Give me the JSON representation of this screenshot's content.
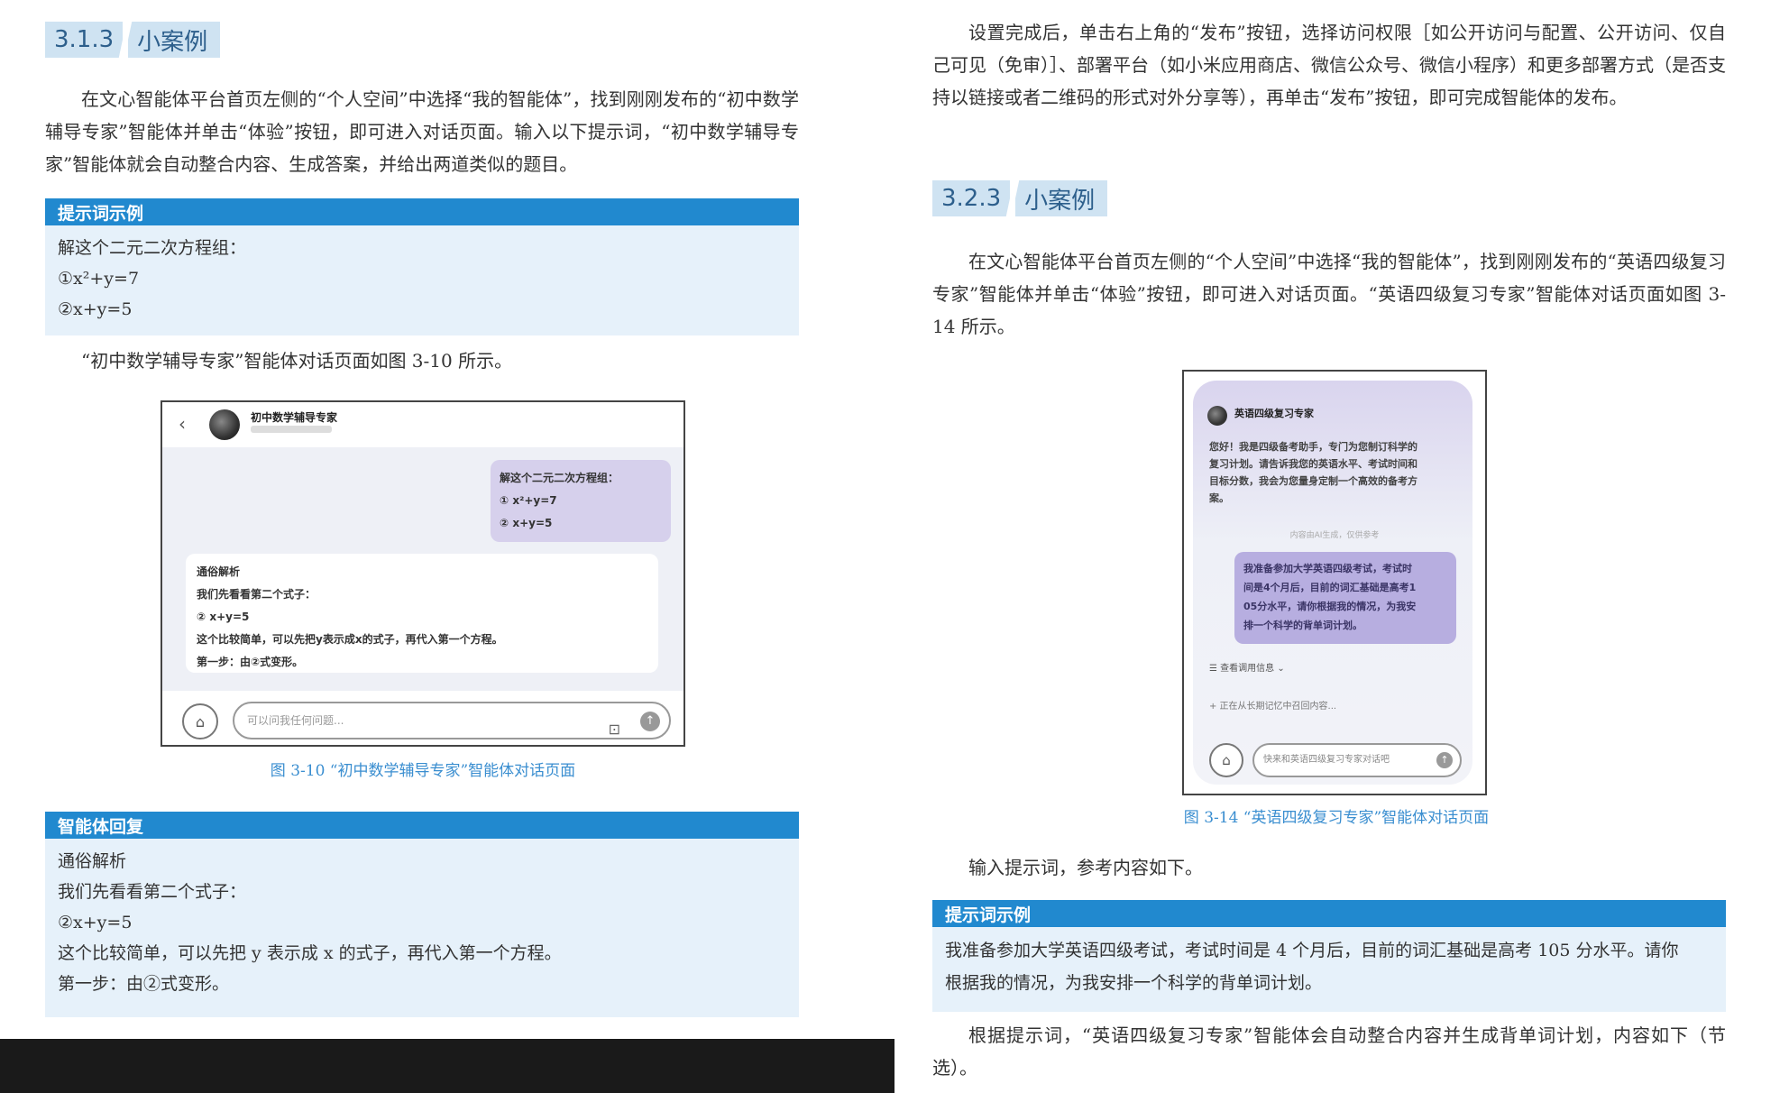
{
  "left": {
    "section": {
      "num": "3.1.3",
      "title": "小案例"
    },
    "intro": "在文心智能体平台首页左侧的“个人空间”中选择“我的智能体”，找到刚刚发布的“初中数学辅导专家”智能体并单击“体验”按钮，即可进入对话页面。输入以下提示词，“初中数学辅导专家”智能体就会自动整合内容、生成答案，并给出两道类似的题目。",
    "prompt_box": {
      "title": "提示词示例",
      "lines": [
        "解这个二元二次方程组：",
        "①x²+y=7",
        "②x+y=5"
      ]
    },
    "after_prompt": "“初中数学辅导专家”智能体对话页面如图 3-10 所示。",
    "figure": {
      "agent_name": "初中数学辅导专家",
      "back_icon": "‹",
      "user_msg": [
        "解这个二元二次方程组：",
        "①  x²+y=7",
        "②  x+y=5"
      ],
      "answer": [
        "通俗解析",
        "我们先看看第二个式子：",
        "②  x+y=5",
        "这个比较简单，可以先把y表示成x的式子，再代入第一个方程。",
        "第一步：由②式变形。"
      ],
      "input_placeholder": "可以问我任何问题...",
      "caption": "图 3-10  “初中数学辅导专家”智能体对话页面"
    },
    "reply_box": {
      "title": "智能体回复",
      "lines": [
        "通俗解析",
        "我们先看看第二个式子：",
        "②x+y=5",
        "这个比较简单，可以先把 y 表示成 x 的式子，再代入第一个方程。",
        "第一步：由②式变形。"
      ]
    }
  },
  "right": {
    "top_para": "设置完成后，单击右上角的“发布”按钮，选择访问权限［如公开访问与配置、公开访问、仅自己可见（免审）］、部署平台（如小米应用商店、微信公众号、微信小程序）和更多部署方式（是否支持以链接或者二维码的形式对外分享等），再单击“发布”按钮，即可完成智能体的发布。",
    "section": {
      "num": "3.2.3",
      "title": "小案例"
    },
    "intro": "在文心智能体平台首页左侧的“个人空间”中选择“我的智能体”，找到刚刚发布的“英语四级复习专家”智能体并单击“体验”按钮，即可进入对话页面。“英语四级复习专家”智能体对话页面如图 3-14 所示。",
    "figure": {
      "agent_name": "英语四级复习专家",
      "greeting": [
        "您好！我是四级备考助手，专门为您制订科学的",
        "复习计划。请告诉我您的英语水平、考试时间和",
        "目标分数，我会为您量身定制一个高效的备考方",
        "案。"
      ],
      "time": "内容由AI生成，仅供参考",
      "user_msg": [
        "我准备参加大学英语四级考试，考试时",
        "间是4个月后，目前的词汇基础是高考1",
        "05分水平，请你根据我的情况，为我安",
        "排一个科学的背单词计划。"
      ],
      "think": "☰ 查看调用信息 ⌄",
      "search": "+ 正在从长期记忆中召回内容...",
      "input_placeholder": "快来和英语四级复习专家对话吧",
      "caption": "图 3-14  “英语四级复习专家”智能体对话页面"
    },
    "after_fig": "输入提示词，参考内容如下。",
    "prompt_box": {
      "title": "提示词示例",
      "lines": [
        "我准备参加大学英语四级考试，考试时间是 4 个月后，目前的词汇基础是高考 105 分水平。请你",
        "根据我的情况，为我安排一个科学的背单词计划。"
      ]
    },
    "closing": "根据提示词，“英语四级复习专家”智能体会自动整合内容并生成背单词计划，内容如下（节选）。"
  }
}
